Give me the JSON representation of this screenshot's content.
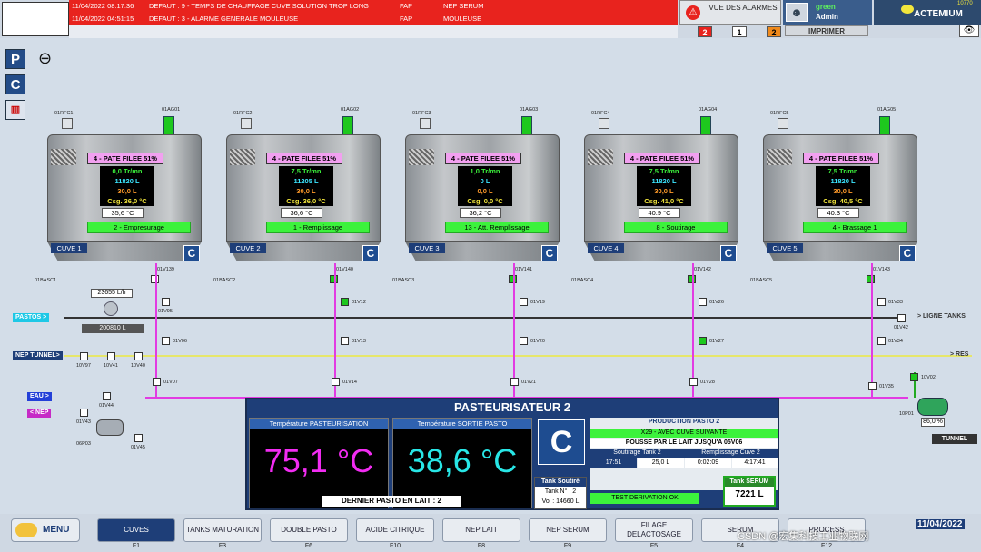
{
  "alarms": [
    {
      "date": "11/04/2022 08:17:36",
      "text": "DEFAUT : 9 - TEMPS DE CHAUFFAGE CUVE SOLUTION TROP LONG",
      "zone": "FAP",
      "area": "NEP SERUM"
    },
    {
      "date": "11/04/2022 04:51:15",
      "text": "DEFAUT : 3 - ALARME GENERALE MOULEUSE",
      "zone": "FAP",
      "area": "MOULEUSE"
    }
  ],
  "header": {
    "alarms_button": "VUE DES ALARMES",
    "count_red": "2",
    "count_white": "1",
    "count_orange": "2",
    "user_status": "green",
    "user_name": "Admin",
    "print_label": "IMPRIMER",
    "brand": "ACTEMIUM",
    "counter": "10770",
    "colors": {
      "alarm": "#e8231e",
      "accent": "#1e3e78",
      "green": "#3cf23c"
    }
  },
  "tanks": [
    {
      "rfc": "01RFC1",
      "ag": "01AG01",
      "recipe": "4 - PATE FILEE 51%",
      "speed": "0,0 Tr/mn",
      "volume": "11820 L",
      "v3": "30,0 L",
      "csg": "Csg. 36,0 °C",
      "temp": "35,6 °C",
      "state": "2 - Empresurage",
      "label": "CUVE 1",
      "basc": "01BASC1",
      "v_out": "01V139"
    },
    {
      "rfc": "01RFC2",
      "ag": "01AG02",
      "recipe": "4 - PATE FILEE 51%",
      "speed": "7,5 Tr/mn",
      "volume": "11205 L",
      "v3": "30,0 L",
      "csg": "Csg. 36,0 °C",
      "temp": "36,6 °C",
      "state": "1 - Remplissage",
      "label": "CUVE 2",
      "basc": "01BASC2",
      "v_out": "01V140"
    },
    {
      "rfc": "01RFC3",
      "ag": "01AG03",
      "recipe": "4 - PATE FILEE 51%",
      "speed": "1,0 Tr/mn",
      "volume": "0 L",
      "v3": "0,0 L",
      "csg": "Csg. 0,0 °C",
      "temp": "36,2 °C",
      "state": "13 - Att. Remplissage",
      "label": "CUVE 3",
      "basc": "01BASC3",
      "v_out": "01V141"
    },
    {
      "rfc": "01RFC4",
      "ag": "01AG04",
      "recipe": "4 - PATE FILEE 51%",
      "speed": "7,5 Tr/mn",
      "volume": "11820 L",
      "v3": "30,0 L",
      "csg": "Csg. 41,0 °C",
      "temp": "40.9 °C",
      "state": "8 - Soutirage",
      "label": "CUVE 4",
      "basc": "01BASC4",
      "v_out": "01V142"
    },
    {
      "rfc": "01RFC5",
      "ag": "01AG05",
      "recipe": "4 - PATE FILEE 51%",
      "speed": "7,5 Tr/mn",
      "volume": "11820 L",
      "v3": "30,0 L",
      "csg": "Csg. 40,5 °C",
      "temp": "40.3 °C",
      "state": "4 - Brassage 1",
      "label": "CUVE 5",
      "basc": "01BASC5",
      "v_out": "01V143"
    }
  ],
  "pipes": {
    "pastos": "PASTOS >",
    "nep_tunnel": "NEP TUNNEL>",
    "eau": "EAU >",
    "nep": "< NEP",
    "ligne_tanks": "> LIGNE TANKS",
    "res": "> RES",
    "tunnel": "TUNNEL",
    "flow": "23655 L/h",
    "counter": "200810 L",
    "pump_pct": "86,0 %"
  },
  "valves": {
    "v95": "01V95",
    "v12": "01V12",
    "v19": "01V19",
    "v26": "01V26",
    "v33": "01V33",
    "v06": "01V06",
    "v13": "01V13",
    "v20": "01V20",
    "v27": "01V27",
    "v34": "01V34",
    "v07": "01V07",
    "v14": "01V14",
    "v21": "01V21",
    "v28": "01V28",
    "v35": "01V35",
    "v42": "01V42",
    "v02": "10V02",
    "v44": "01V44",
    "v43": "01V43",
    "v45": "01V45",
    "v97": "10V97",
    "v41": "10V41",
    "v40": "10V40",
    "p03": "06P03",
    "p01": "10P01"
  },
  "pasto": {
    "title": "PASTEURISATEUR 2",
    "t1_label": "Température PASTEURISATION",
    "t1": "75,1 °C",
    "t2_label": "Température SORTIE PASTO",
    "t2": "38,6 °C",
    "last": "DERNIER PASTO EN LAIT : 2",
    "soutire_title": "Tank Soutiré",
    "soutire_num": "Tank N° : 2",
    "soutire_vol": "Vol : 14660 L",
    "prod_title": "PRODUCTION PASTO 2",
    "prod_state": "X29 - AVEC CUVE SUIVANTE",
    "prod_msg": "POUSSE PAR LE LAIT JUSQU'A 05V06",
    "s_label": "Soutirage Tank 2",
    "s_time": "17:51",
    "s_vol": "25,0 L",
    "r_label": "Remplissage Cuve 2",
    "r_t1": "0:02:09",
    "r_t2": "4:17:41",
    "test": "TEST DERIVATION OK",
    "serum_title": "Tank SERUM",
    "serum_vol": "7221 L"
  },
  "nav": {
    "menu": "MENU",
    "items": [
      {
        "label": "CUVES",
        "key": "F1"
      },
      {
        "label": "TANKS MATURATION",
        "key": "F3"
      },
      {
        "label": "DOUBLE PASTO",
        "key": "F6"
      },
      {
        "label": "ACIDE CITRIQUE",
        "key": "F10"
      },
      {
        "label": "NEP LAIT",
        "key": "F8"
      },
      {
        "label": "NEP SERUM",
        "key": "F9"
      },
      {
        "label": "FILAGE DELACTOSAGE",
        "key": "F5"
      },
      {
        "label": "SERUM",
        "key": "F4"
      },
      {
        "label": "PROCESS",
        "key": "F12"
      }
    ],
    "date": "11/04/2022",
    "watermark": "CSDN @宏集科技工业物联网"
  }
}
